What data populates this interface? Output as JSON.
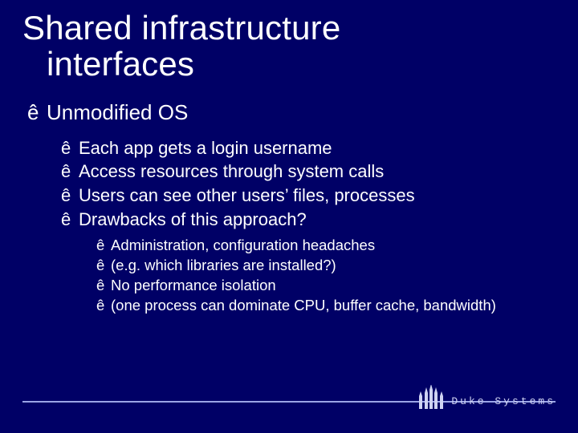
{
  "title": {
    "line1": "Shared infrastructure",
    "line2": "interfaces"
  },
  "bullet_glyph": "ê",
  "level1": {
    "text": "Unmodified OS"
  },
  "level2": [
    {
      "text": "Each app gets a login username"
    },
    {
      "text": "Access resources through system calls"
    },
    {
      "text": "Users can see other users’ files, processes"
    },
    {
      "text": "Drawbacks of this approach?"
    }
  ],
  "level3": [
    {
      "text": "Administration, configuration headaches"
    },
    {
      "text": "(e.g. which libraries are installed?)"
    },
    {
      "text": "No performance isolation"
    },
    {
      "text": "(one process can dominate CPU, buffer cache, bandwidth)"
    }
  ],
  "brand": "Duke Systems",
  "colors": {
    "bg": "#000066",
    "rule": "#9aa4e6",
    "brand": "#cfd3f2"
  }
}
